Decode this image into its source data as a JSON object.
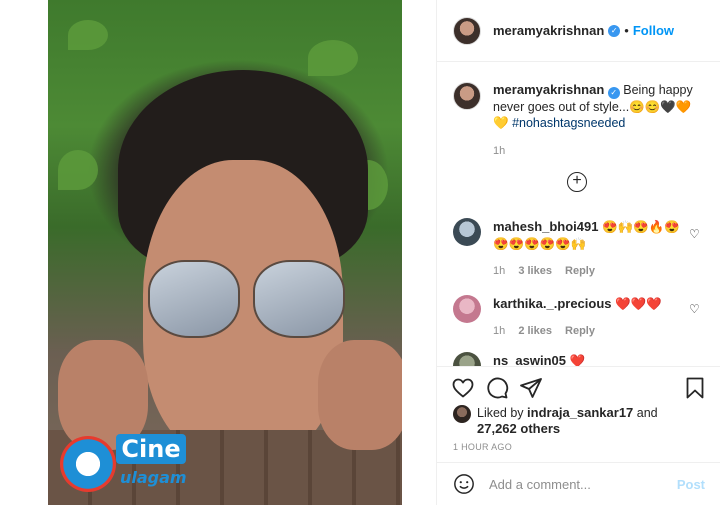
{
  "post": {
    "author": "meramyakrishnan",
    "follow_label": "Follow",
    "caption_text": "Being happy never goes out of style...😊😊🖤🧡💛",
    "hashtag": "#nohashtagsneeded",
    "caption_time": "1h",
    "more_comments_label": "+"
  },
  "comments": [
    {
      "user": "mahesh_bhoi491",
      "text": "😍🙌😍🔥😍😍😍😍😍😍🙌",
      "time": "1h",
      "likes": "3 likes",
      "reply": "Reply"
    },
    {
      "user": "karthika._.precious",
      "text": "❤️❤️❤️",
      "time": "1h",
      "likes": "2 likes",
      "reply": "Reply"
    },
    {
      "user": "ns_aswin05",
      "text": "❤️"
    }
  ],
  "likes": {
    "prefix": "Liked by",
    "user": "indraja_sankar17",
    "and": "and",
    "others": "27,262 others"
  },
  "timestamp": "1 HOUR AGO",
  "add_comment": {
    "placeholder": "Add a comment...",
    "post_label": "Post"
  },
  "watermark": {
    "brand": "Cine",
    "sub": "ulagam"
  },
  "colors": {
    "link_blue": "#0095f6",
    "post_disabled": "#b2dffc",
    "meta_gray": "#8e8e8e"
  },
  "icons": [
    "heart-icon",
    "comment-icon",
    "share-icon",
    "save-icon",
    "emoji-icon",
    "verified-icon",
    "plus-circle-icon"
  ]
}
